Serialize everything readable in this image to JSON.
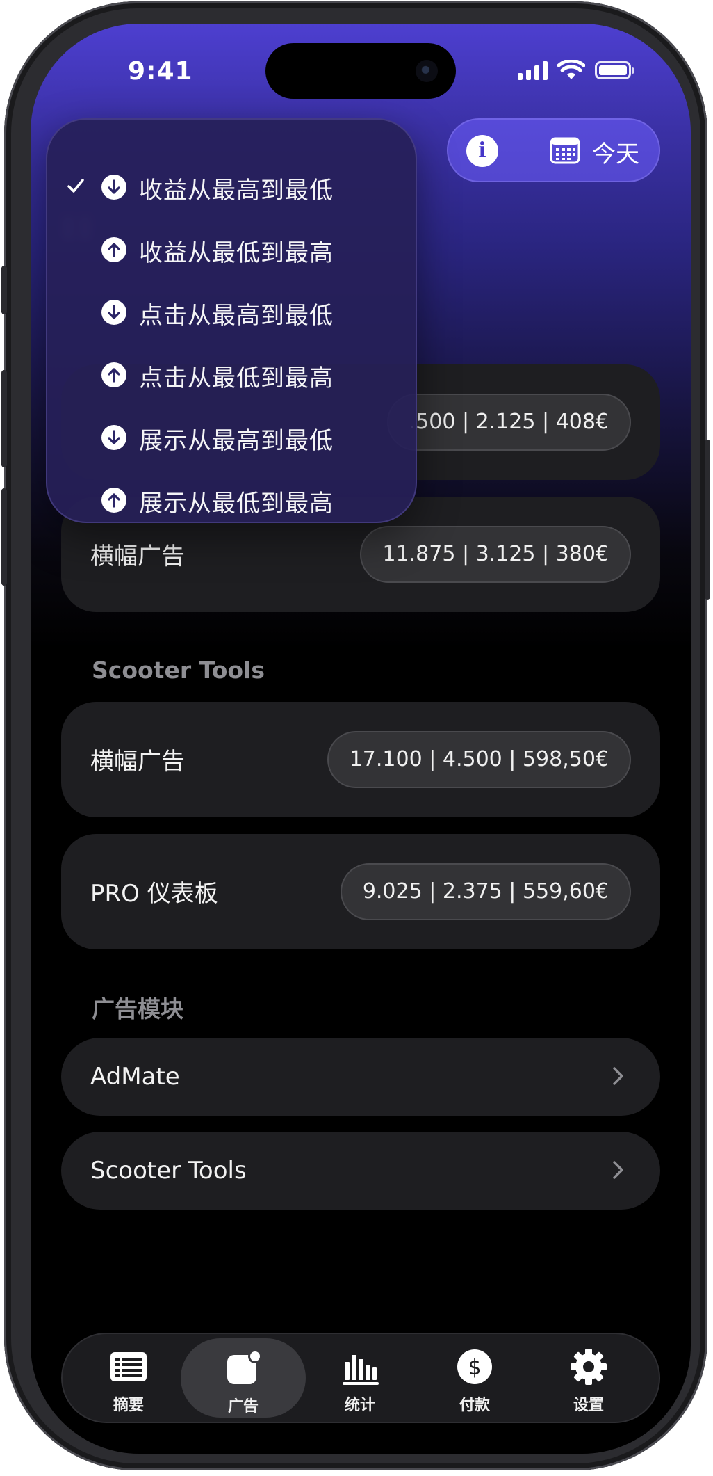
{
  "status": {
    "time": "9:41"
  },
  "top_bar": {
    "date_filter_label": "今天"
  },
  "sort_menu": {
    "items": [
      {
        "label": "收益从最高到最低",
        "direction": "down",
        "selected": true
      },
      {
        "label": "收益从最低到最高",
        "direction": "up",
        "selected": false
      },
      {
        "label": "点击从最高到最低",
        "direction": "down",
        "selected": false
      },
      {
        "label": "点击从最低到最高",
        "direction": "up",
        "selected": false
      },
      {
        "label": "展示从最高到最低",
        "direction": "down",
        "selected": false
      },
      {
        "label": "展示从最低到最高",
        "direction": "up",
        "selected": false
      }
    ]
  },
  "groups": [
    {
      "title": "",
      "rows": [
        {
          "label": "",
          "stats": ".500 | 2.125 | 408€"
        },
        {
          "label": "横幅广告",
          "stats": "11.875 | 3.125 | 380€"
        }
      ]
    },
    {
      "title": "Scooter Tools",
      "rows": [
        {
          "label": "横幅广告",
          "stats": "17.100 | 4.500 | 598,50€"
        },
        {
          "label": "PRO 仪表板",
          "stats": "9.025 | 2.375 | 559,60€"
        }
      ]
    }
  ],
  "modules": {
    "title": "广告模块",
    "items": [
      {
        "label": "AdMate"
      },
      {
        "label": "Scooter Tools"
      }
    ]
  },
  "tabs": [
    {
      "label": "摘要",
      "icon": "list-icon",
      "active": false
    },
    {
      "label": "广告",
      "icon": "ad-badge-icon",
      "active": true
    },
    {
      "label": "统计",
      "icon": "bar-chart-icon",
      "active": false
    },
    {
      "label": "付款",
      "icon": "dollar-icon",
      "active": false
    },
    {
      "label": "设置",
      "icon": "gear-icon",
      "active": false
    }
  ],
  "colors": {
    "accent": "#4d3fd0",
    "card": "#1e1e21",
    "pill": "#333336",
    "section_title": "#8e8e93"
  }
}
